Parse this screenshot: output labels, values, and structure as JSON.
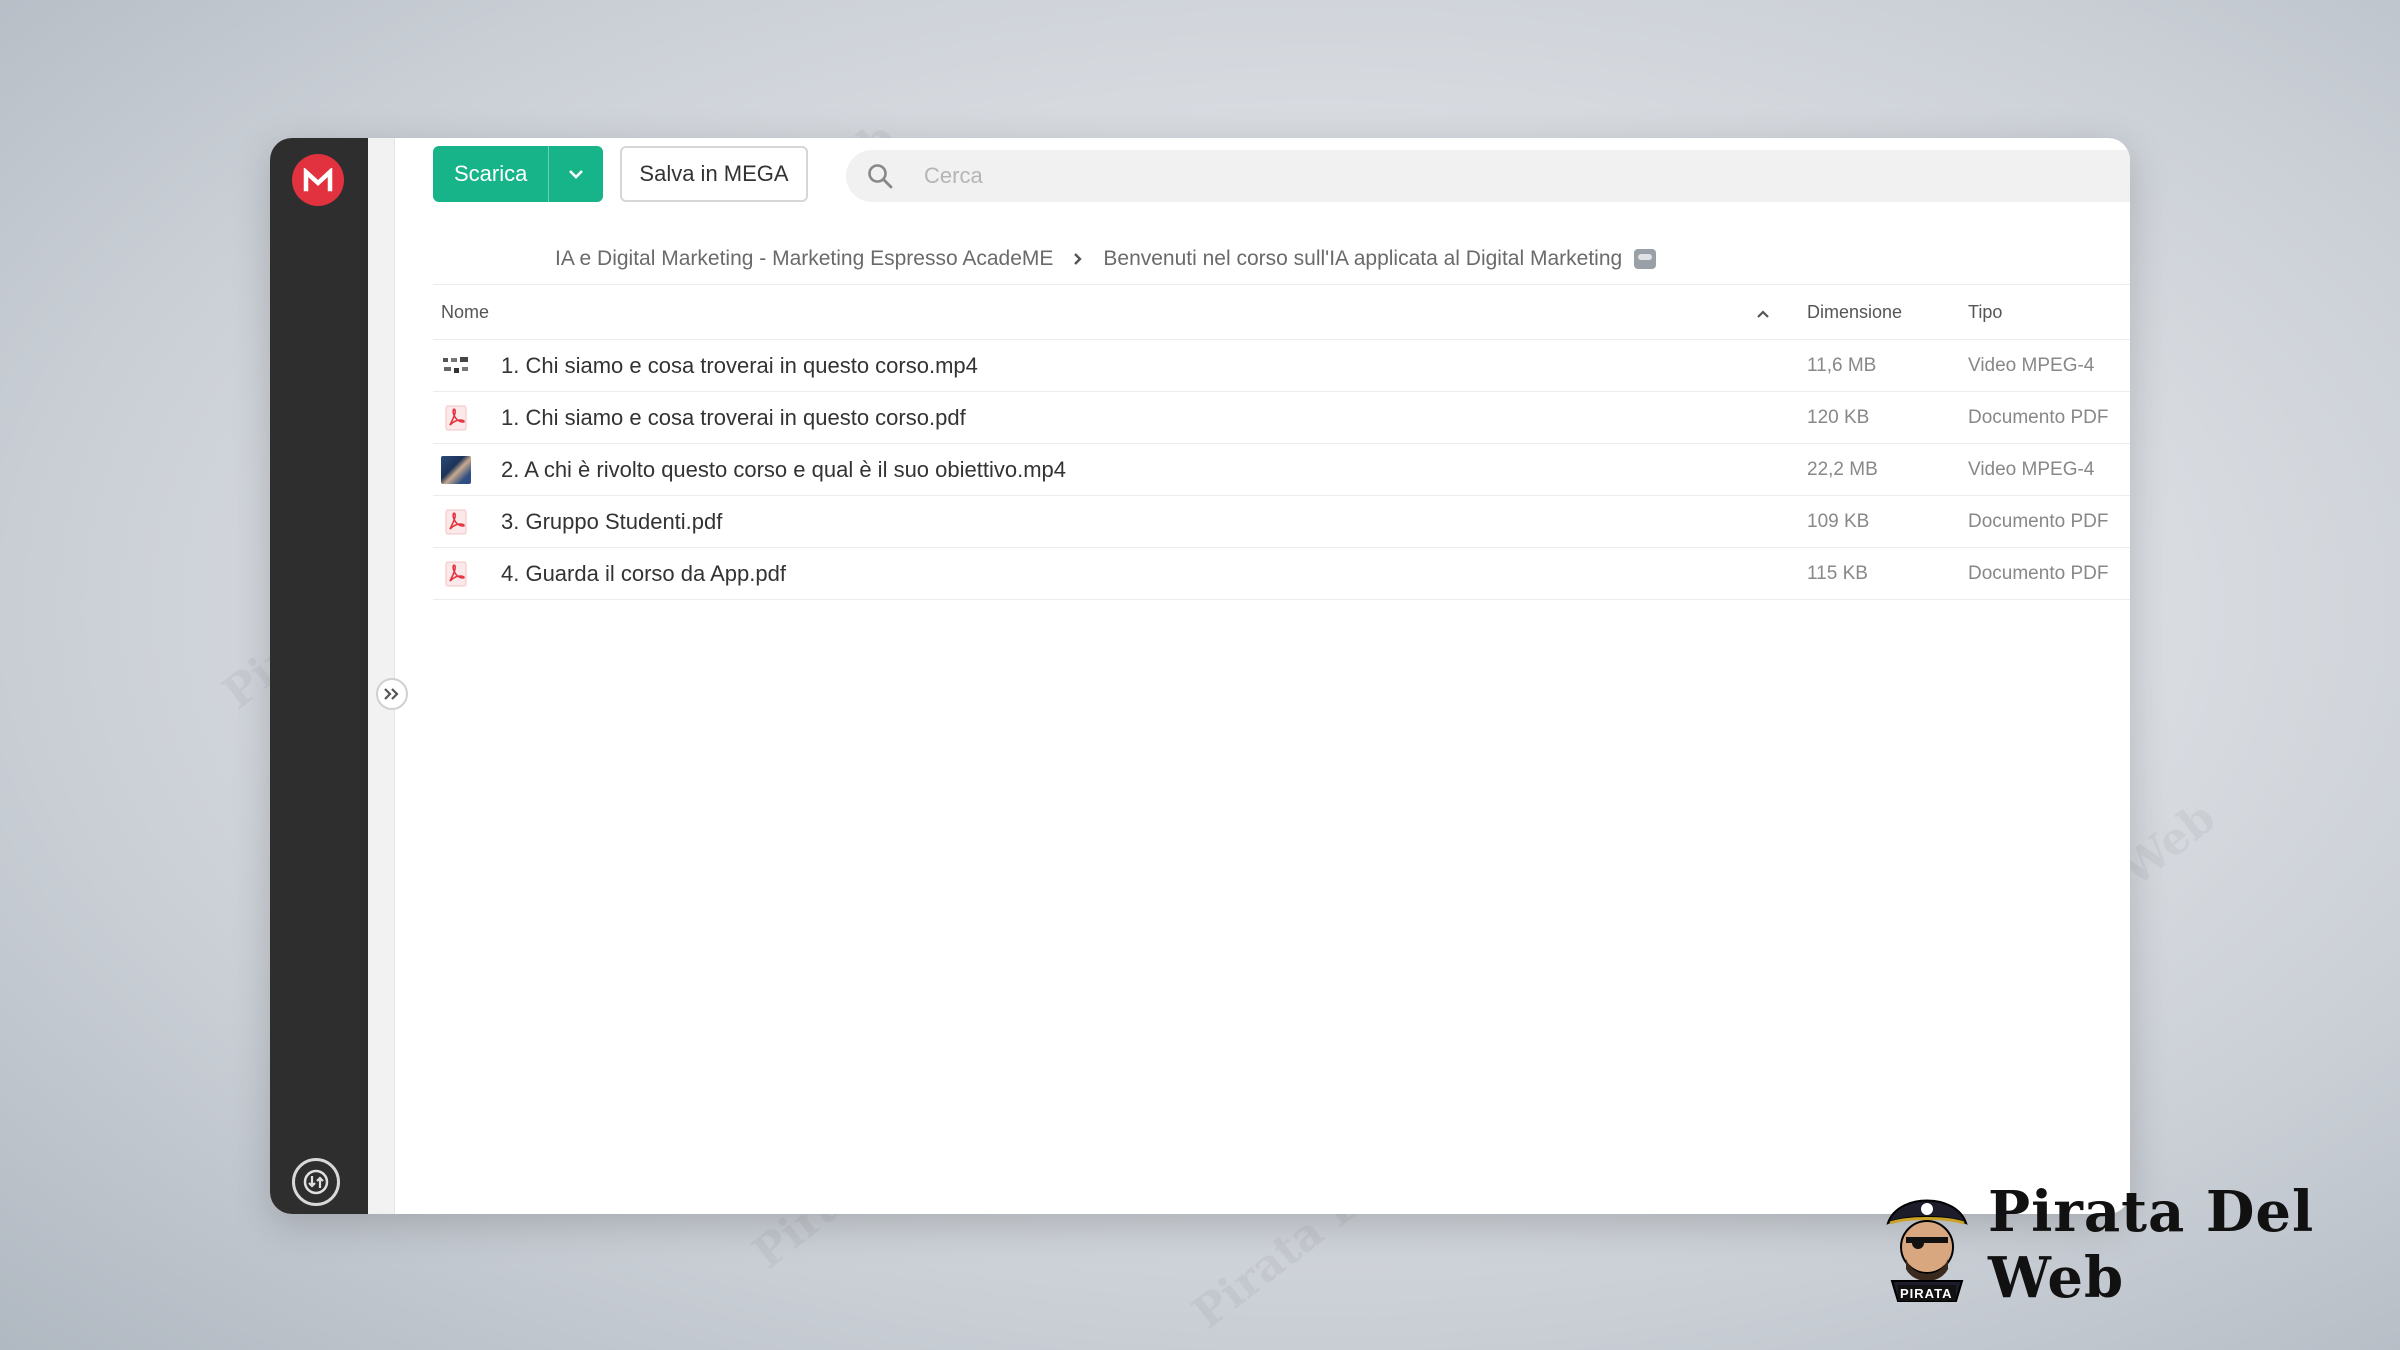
{
  "toolbar": {
    "download_label": "Scarica",
    "save_label": "Salva in MEGA"
  },
  "search": {
    "placeholder": "Cerca"
  },
  "breadcrumb": {
    "items": [
      "IA e Digital Marketing - Marketing Espresso AcadeME",
      "Benvenuti nel corso sull'IA applicata al Digital Marketing"
    ]
  },
  "table": {
    "columns": {
      "name": "Nome",
      "size": "Dimensione",
      "type": "Tipo"
    },
    "rows": [
      {
        "name": "1. Chi siamo e cosa troverai in questo corso.mp4",
        "size": "11,6 MB",
        "type": "Video MPEG-4",
        "icon": "video-thumbnail-icon"
      },
      {
        "name": "1. Chi siamo e cosa troverai in questo corso.pdf",
        "size": "120 KB",
        "type": "Documento PDF",
        "icon": "pdf-icon"
      },
      {
        "name": "2. A chi è rivolto questo corso e qual è il suo obiettivo.mp4",
        "size": "22,2 MB",
        "type": "Video MPEG-4",
        "icon": "video-thumbnail-icon"
      },
      {
        "name": "3. Gruppo Studenti.pdf",
        "size": "109 KB",
        "type": "Documento PDF",
        "icon": "pdf-icon"
      },
      {
        "name": "4. Guarda il corso da App.pdf",
        "size": "115 KB",
        "type": "Documento PDF",
        "icon": "pdf-icon"
      }
    ]
  },
  "watermark": {
    "text": "Pirata Del Web"
  },
  "brand": {
    "name": "Pirata Del Web",
    "badge": "PIRATA"
  },
  "colors": {
    "accent_green": "#17b389",
    "mega_red": "#e2323f",
    "sidebar_dark": "#2e2e2e",
    "pdf_red": "#e2323f"
  }
}
